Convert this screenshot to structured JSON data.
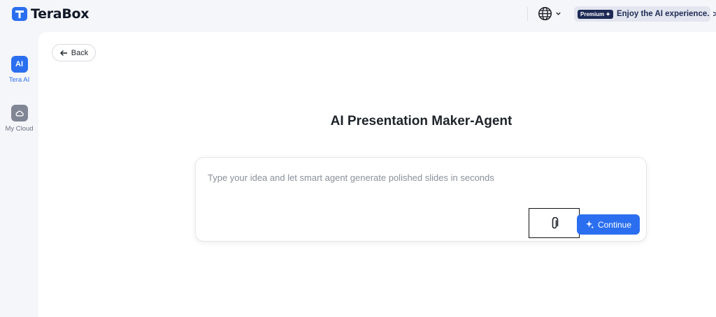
{
  "app": {
    "logo_text": "TeraBox",
    "brand_color": "#2b6ff0"
  },
  "header": {
    "language_icon": "globe-icon",
    "premium_badge": "Premium",
    "premium_text": "Enjoy the AI experience.",
    "premium_chevron": ">"
  },
  "sidebar": {
    "items": [
      {
        "icon_text": "AI",
        "label": "Tera AI",
        "icon": "ai-icon",
        "active": true
      },
      {
        "label": "My Cloud",
        "icon": "cloud-icon",
        "active": false
      }
    ]
  },
  "main": {
    "back_label": "Back",
    "title": "AI Presentation Maker-Agent",
    "prompt": {
      "value": "",
      "placeholder": "Type your idea and let smart agent generate polished slides in seconds"
    },
    "attach_icon": "paperclip-icon",
    "continue_label": "Continue"
  }
}
